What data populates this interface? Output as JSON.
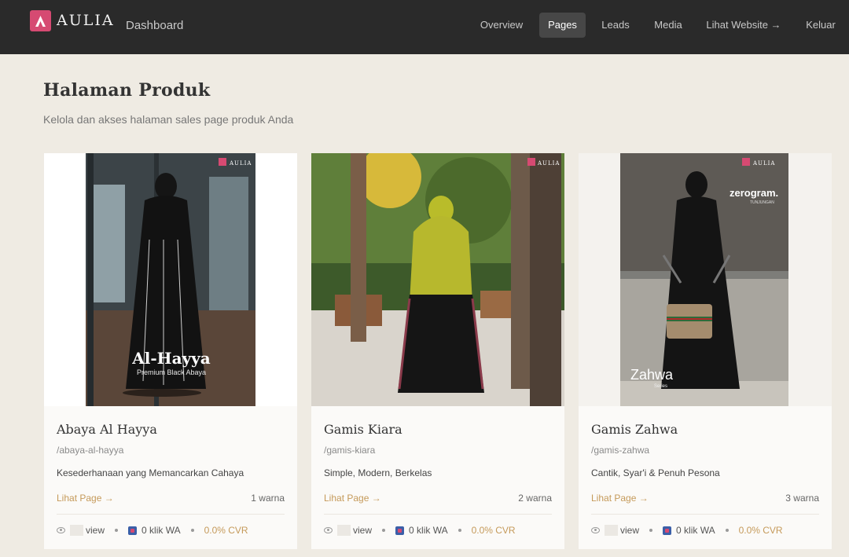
{
  "header": {
    "brand": "AULIA",
    "section": "Dashboard",
    "nav": [
      {
        "label": "Overview",
        "active": false
      },
      {
        "label": "Pages",
        "active": true
      },
      {
        "label": "Leads",
        "active": false
      },
      {
        "label": "Media",
        "active": false
      },
      {
        "label": "Lihat Website →",
        "active": false
      },
      {
        "label": "Keluar",
        "active": false
      }
    ]
  },
  "page": {
    "title": "Halaman Produk",
    "subtitle": "Kelola dan akses halaman sales page produk Anda"
  },
  "products": [
    {
      "name": "Abaya Al Hayya",
      "slug": "/abaya-al-hayya",
      "tagline": "Kesederhanaan yang Memancarkan Cahaya",
      "link_label": "Lihat Page →",
      "colors": "1 warna",
      "views_label": "view",
      "wa_clicks": "0 klik WA",
      "cvr": "0.0% CVR",
      "image_brand": "AULIA",
      "image_title": "Al-Hayya",
      "image_caption": "Premium Black Abaya"
    },
    {
      "name": "Gamis Kiara",
      "slug": "/gamis-kiara",
      "tagline": "Simple, Modern, Berkelas",
      "link_label": "Lihat Page →",
      "colors": "2 warna",
      "views_label": "view",
      "wa_clicks": "0 klik WA",
      "cvr": "0.0% CVR",
      "image_brand": "AULIA"
    },
    {
      "name": "Gamis Zahwa",
      "slug": "/gamis-zahwa",
      "tagline": "Cantik, Syar'i & Penuh Pesona",
      "link_label": "Lihat Page →",
      "colors": "3 warna",
      "views_label": "view",
      "wa_clicks": "0 klik WA",
      "cvr": "0.0% CVR",
      "image_brand": "AULIA",
      "image_title": "Zahwa",
      "image_caption": "Series",
      "image_sign": "zerogram.",
      "image_sign_sub": "TUNJUNGAN"
    }
  ],
  "colors": {
    "header_bg": "#2a2a2a",
    "page_bg": "#efebe3",
    "brand": "#d64a72",
    "accent": "#c59a5a"
  },
  "icons": [
    "aulia-logo-icon",
    "eye-icon",
    "whatsapp-icon"
  ]
}
